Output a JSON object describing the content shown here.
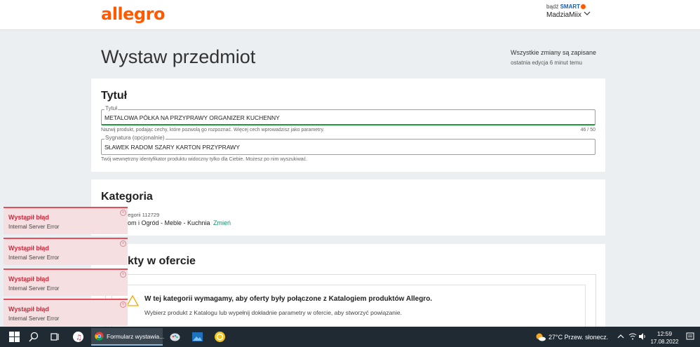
{
  "header": {
    "logo": "allegro",
    "smart_prefix": "bądź",
    "smart_label": "SMART",
    "username": "MadziaMiix"
  },
  "page": {
    "title": "Wystaw przedmiot",
    "save_status": "Wszystkie zmiany są zapisane",
    "save_sub": "ostatnia edycja 6 minut temu"
  },
  "title_section": {
    "heading": "Tytuł",
    "title_label": "Tytuł",
    "title_value": "METALOWA PÓŁKA NA PRZYPRAWY ORGANIZER KUCHENNY",
    "title_hint": "Nazwij produkt, podając cechy, które pozwolą go rozpoznać. Więcej cech wprowadzisz jako parametry.",
    "title_counter": "46  /  50",
    "signature_label": "Sygnatura (opcjonalnie)",
    "signature_value": "SŁAWEK RADOM SZARY KARTON PRZYPRAWY",
    "signature_hint": "Twój wewnętrzny identyfikator produktu widoczny tylko dla Ciebie. Możesz po nim wyszukiwać."
  },
  "category_section": {
    "heading": "Kategoria",
    "category_number": "ategorii 112729",
    "category_path": "om i Ogród - Meble - Kuchnia",
    "change_link": "Zmień"
  },
  "products_section": {
    "heading": "kty w ofercie",
    "info_title": "W tej kategorii wymagamy, aby oferty były połączone z Katalogiem produktów Allegro.",
    "info_text": "Wybierz produkt z Katalogu lub wypełnij dokładnie parametry w ofercie, aby stworzyć powiązanie."
  },
  "toasts": [
    {
      "title": "Wystąpił błąd",
      "message": "Internal Server Error"
    },
    {
      "title": "Wystąpił błąd",
      "message": "Internal Server Error"
    },
    {
      "title": "Wystąpił błąd",
      "message": "Internal Server Error"
    },
    {
      "title": "Wystąpił błąd",
      "message": "Internal Server Error"
    }
  ],
  "taskbar": {
    "active_app": "Formularz wystawia...",
    "weather": "27°C  Przew. słonecz.",
    "time": "12:59",
    "date": "17.08.2022"
  },
  "colors": {
    "brand": "#ff5a00",
    "error": "#d4263a",
    "active_border": "#1e9b3b",
    "link": "#1e8c6a"
  }
}
